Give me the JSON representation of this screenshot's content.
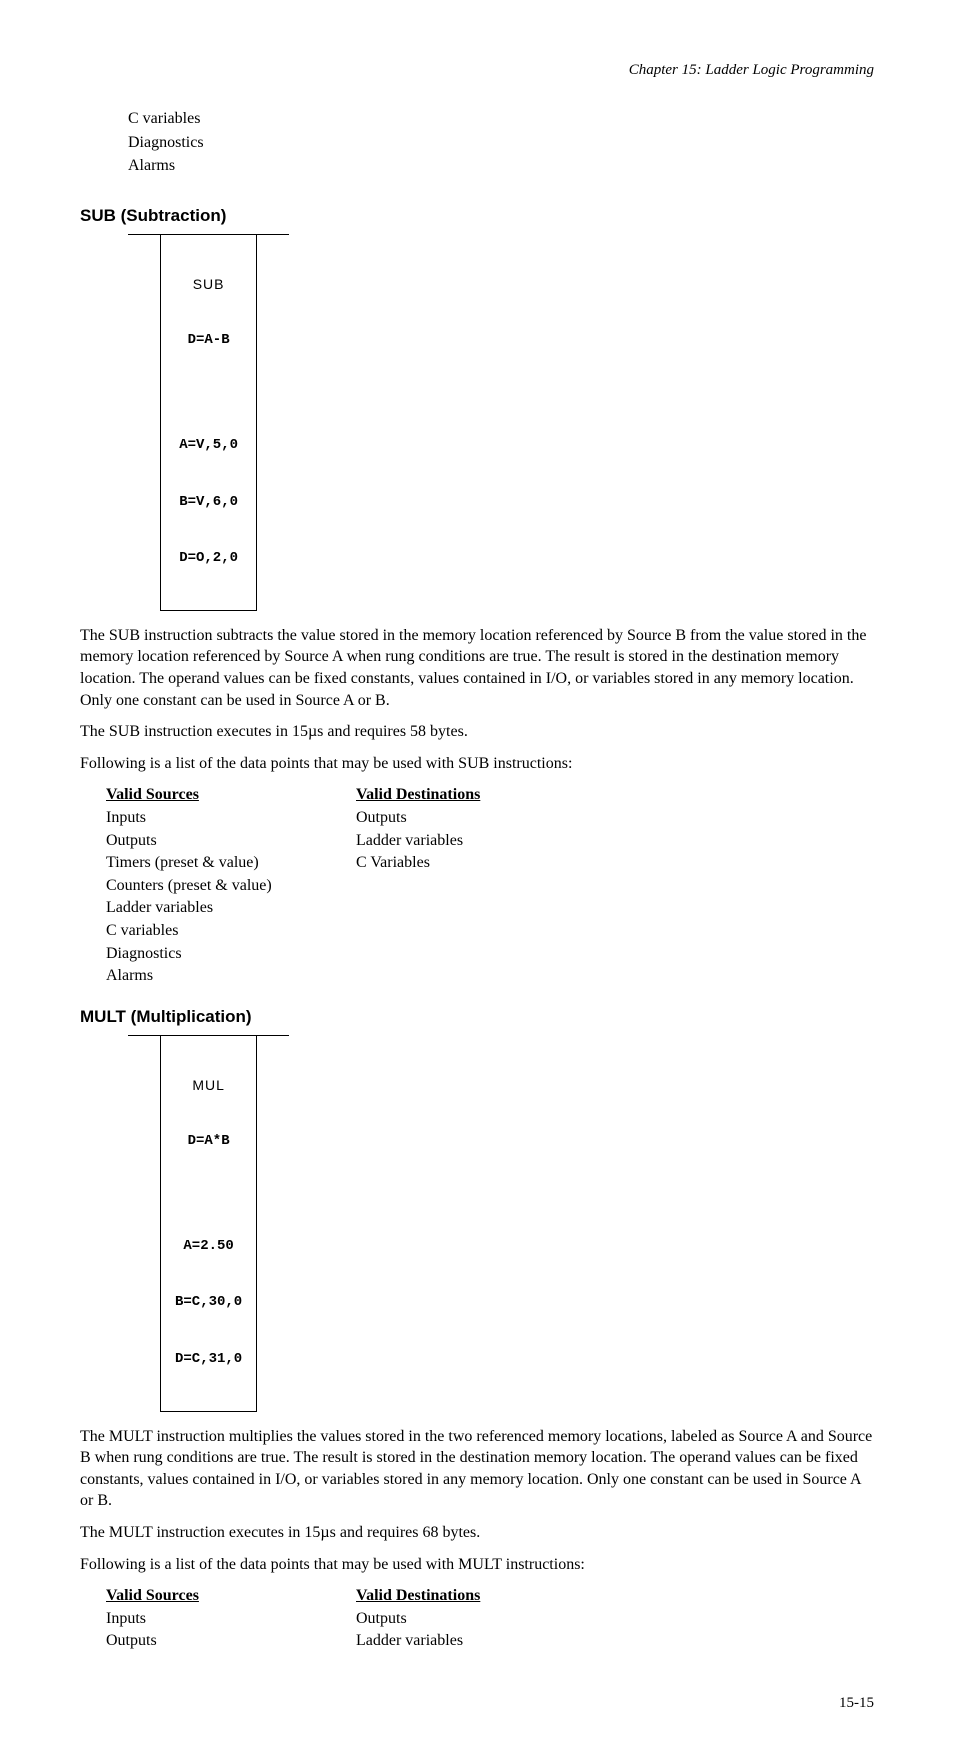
{
  "header": {
    "text": "Chapter 15: Ladder Logic Programming"
  },
  "topList": {
    "items": [
      "C variables",
      "Diagnostics",
      "Alarms"
    ]
  },
  "sub": {
    "heading": "SUB (Subtraction)",
    "box": {
      "title": "SUB",
      "expr": "D=A-B",
      "lines": [
        "A=V,5,0",
        "B=V,6,0",
        "D=O,2,0"
      ]
    },
    "para1": "The SUB instruction subtracts the value stored in the memory location referenced by Source B from the value stored in the memory location referenced by Source A when rung conditions are true. The result is stored in the destination memory location. The operand values can be fixed constants, values contained in I/O, or variables stored in any memory location.   Only one constant can be used in Source A or B.",
    "para2": "The SUB instruction executes in 15µs and requires 58 bytes.",
    "para3": "Following is a list of the data points that may be used with SUB instructions:",
    "sourcesHead": "Valid Sources",
    "sources": [
      "Inputs",
      "Outputs",
      "Timers (preset & value)",
      "Counters (preset & value)",
      "Ladder variables",
      "C variables",
      "Diagnostics",
      "Alarms"
    ],
    "destsHead": "Valid Destinations",
    "dests": [
      "Outputs",
      "Ladder variables",
      "C Variables"
    ]
  },
  "mult": {
    "heading": "MULT (Multiplication)",
    "box": {
      "title": "MUL",
      "expr": "D=A*B",
      "lines": [
        "A=2.50",
        "B=C,30,0",
        "D=C,31,0"
      ]
    },
    "para1": "The MULT instruction multiplies the values stored in the two referenced memory locations, labeled as Source A and Source B when rung conditions are true. The result is stored in the destination memory location. The operand values can be fixed constants, values contained in I/O, or variables stored in any memory location.  Only one constant can be used in Source A or B.",
    "para2": "The MULT instruction executes in 15µs and requires 68 bytes.",
    "para3": "Following is a list of the data points that may be used with MULT instructions:",
    "sourcesHead": "Valid Sources",
    "sources": [
      "Inputs",
      "Outputs"
    ],
    "destsHead": "Valid Destinations",
    "dests": [
      "Outputs",
      "Ladder variables"
    ]
  },
  "pageNumber": "15-15"
}
